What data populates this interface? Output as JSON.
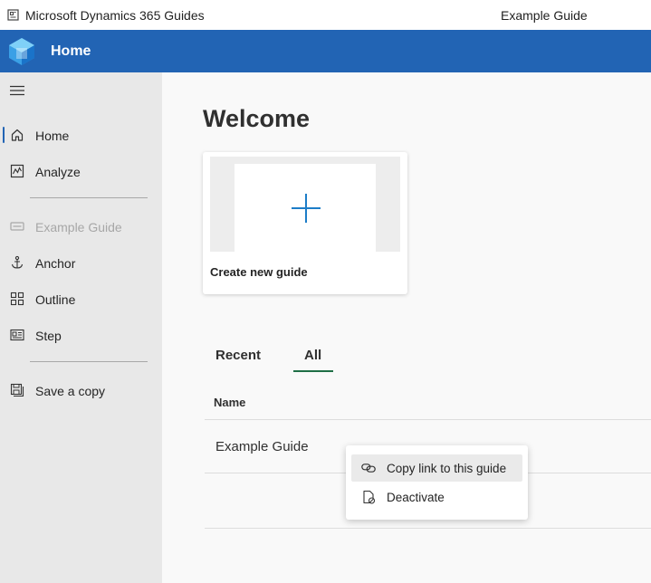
{
  "window": {
    "app_title": "Microsoft Dynamics 365 Guides",
    "document_title": "Example Guide"
  },
  "header": {
    "title": "Home",
    "background_color": "#2264b4"
  },
  "sidebar": {
    "menu_icon": "hamburger-icon",
    "items": [
      {
        "label": "Home",
        "icon": "home-icon"
      },
      {
        "label": "Analyze",
        "icon": "analyze-icon"
      },
      {
        "label": "Example Guide",
        "icon": "guide-icon"
      },
      {
        "label": "Anchor",
        "icon": "anchor-icon"
      },
      {
        "label": "Outline",
        "icon": "outline-icon"
      },
      {
        "label": "Step",
        "icon": "step-icon"
      },
      {
        "label": "Save a copy",
        "icon": "save-copy-icon"
      }
    ]
  },
  "main": {
    "heading": "Welcome",
    "create_card": {
      "label": "Create new guide",
      "icon": "plus-icon",
      "accent_color": "#1d7dc8"
    },
    "tabs": [
      {
        "label": "Recent"
      },
      {
        "label": "All"
      }
    ],
    "table": {
      "column_name": "Name",
      "rows": [
        {
          "name": "Example Guide"
        }
      ]
    }
  },
  "context_menu": {
    "items": [
      {
        "label": "Copy link to this guide",
        "icon": "link-icon"
      },
      {
        "label": "Deactivate",
        "icon": "deactivate-icon"
      }
    ]
  }
}
